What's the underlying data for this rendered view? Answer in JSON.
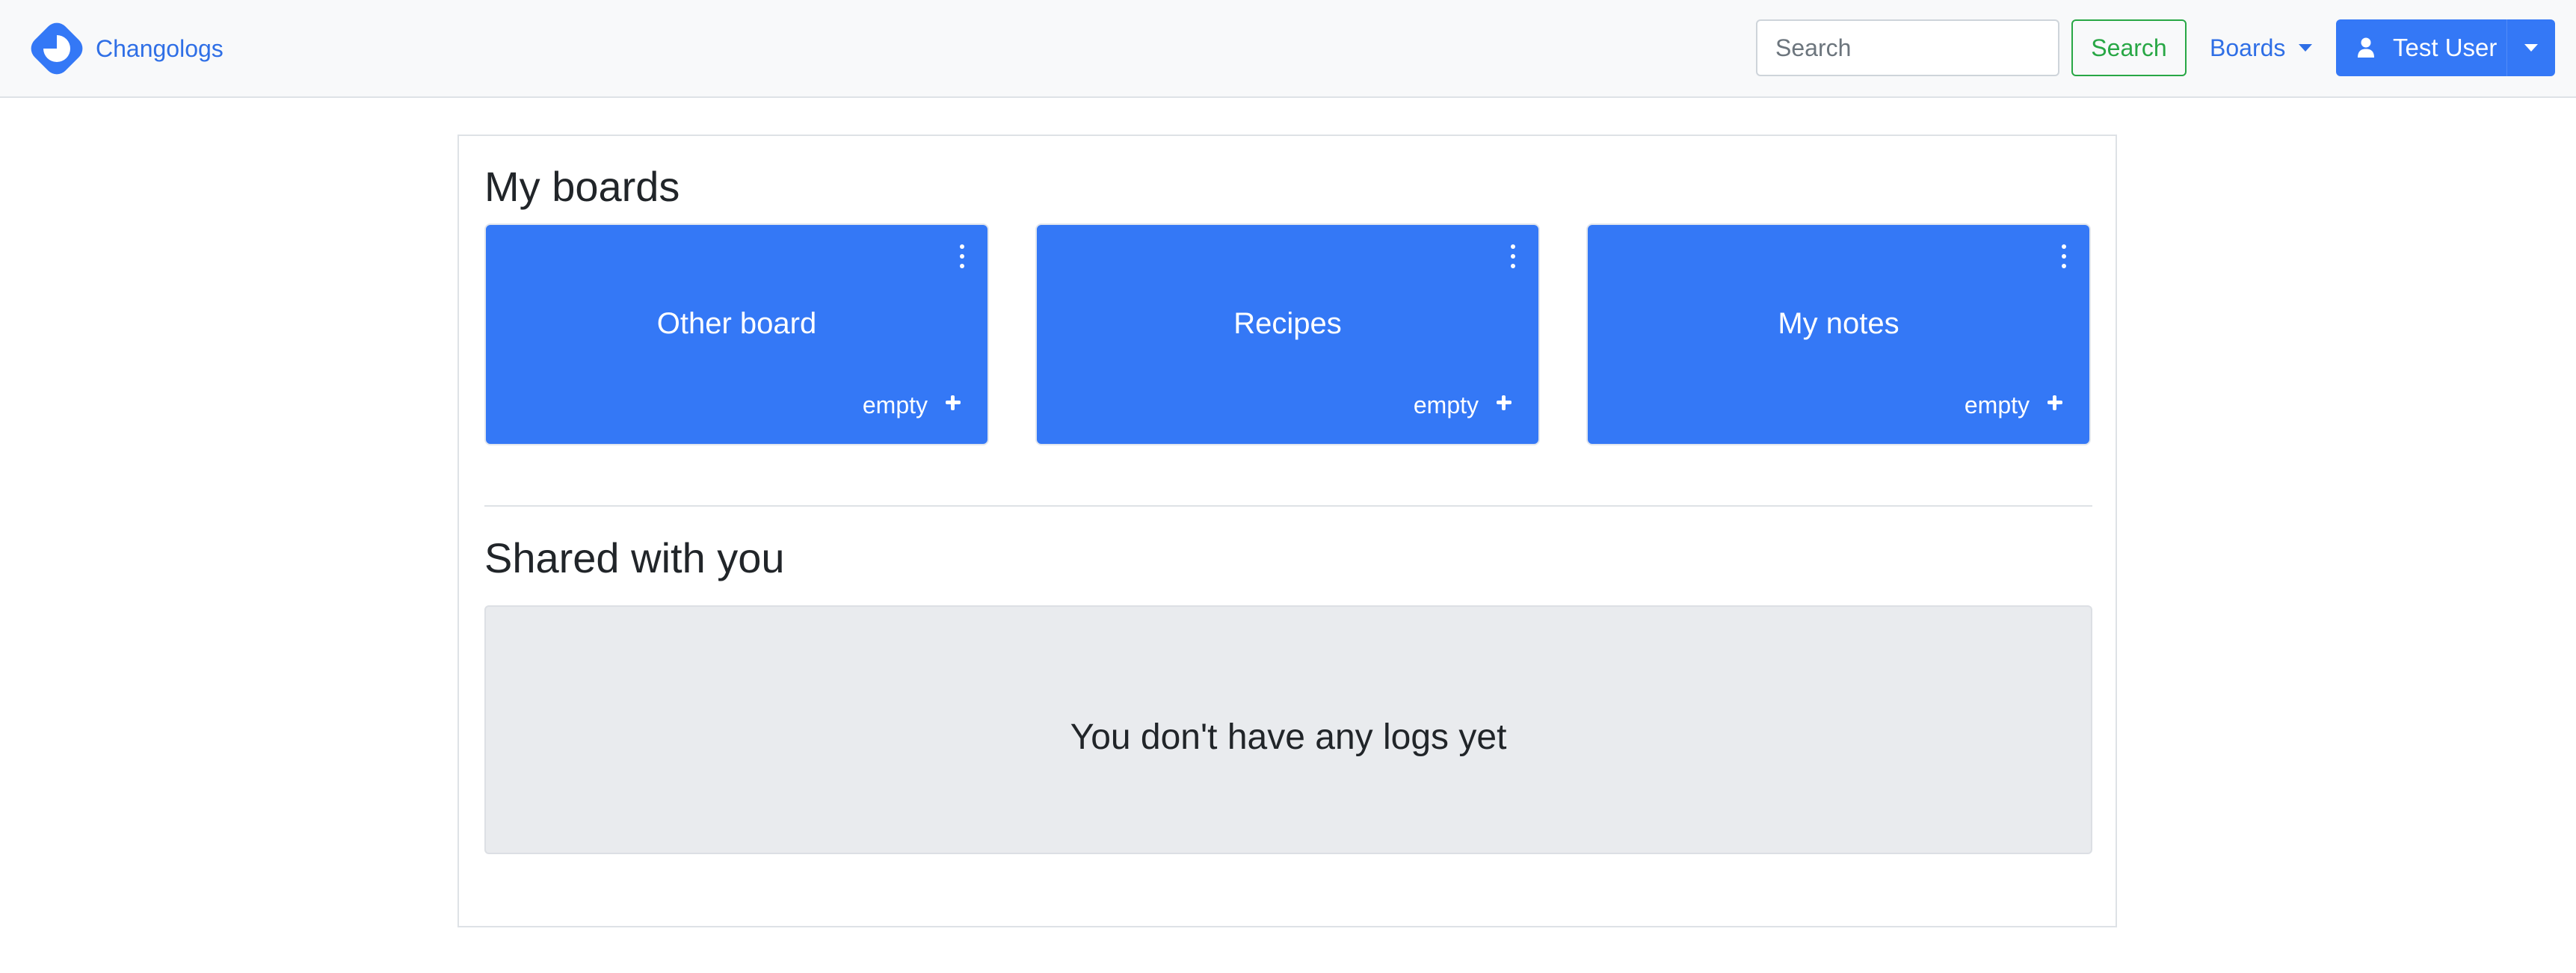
{
  "brand": {
    "name": "Changologs",
    "logo_icon": "changologs-logo-icon",
    "color": "#2f6fe6"
  },
  "navbar": {
    "search": {
      "placeholder": "Search",
      "value": "",
      "button_label": "Search",
      "button_color": "#28a745"
    },
    "boards_menu": {
      "label": "Boards"
    },
    "user_menu": {
      "name": "Test User",
      "icon": "user-icon",
      "color": "#3478f6"
    }
  },
  "main": {
    "my_boards": {
      "title": "My boards",
      "boards": [
        {
          "title": "Other board",
          "status": "empty"
        },
        {
          "title": "Recipes",
          "status": "empty"
        },
        {
          "title": "My notes",
          "status": "empty"
        }
      ],
      "card_color": "#3478f6"
    },
    "shared": {
      "title": "Shared with you",
      "empty_message": "You don't have any logs yet"
    }
  }
}
